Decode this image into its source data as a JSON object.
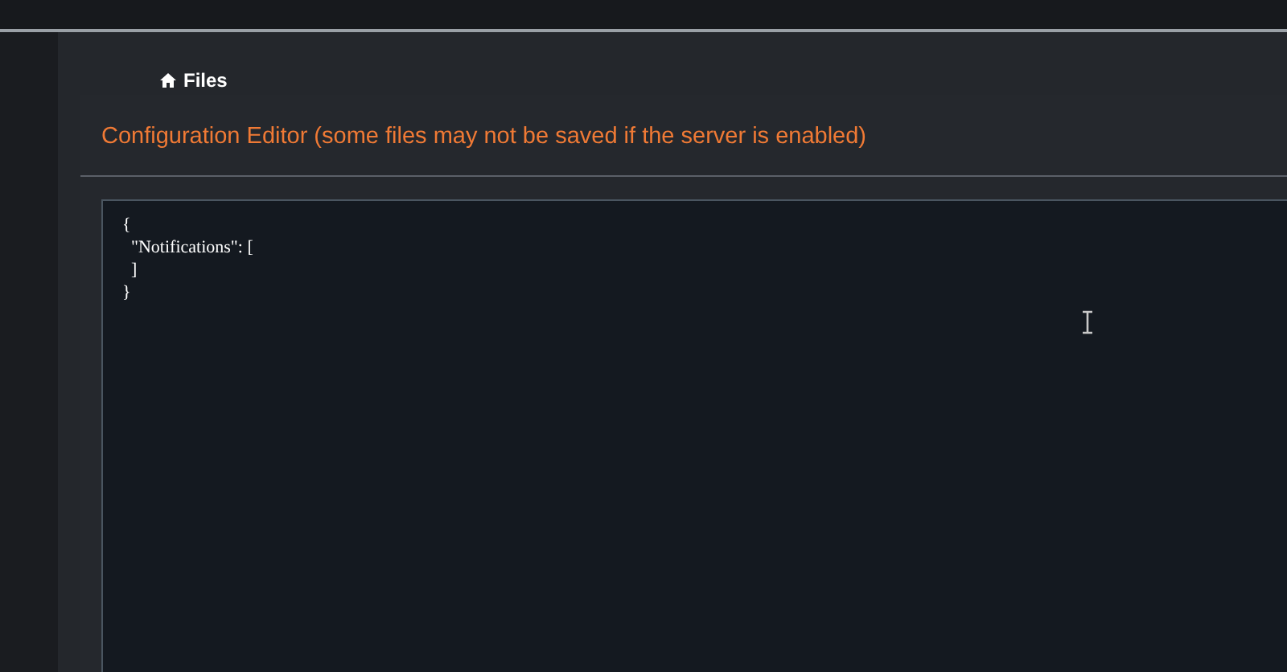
{
  "breadcrumb": {
    "label": "Files"
  },
  "title": "Configuration Editor (some files may not be saved if the server is enabled)",
  "editor": {
    "value": "{\n  \"Notifications\": [\n  ]\n}"
  }
}
